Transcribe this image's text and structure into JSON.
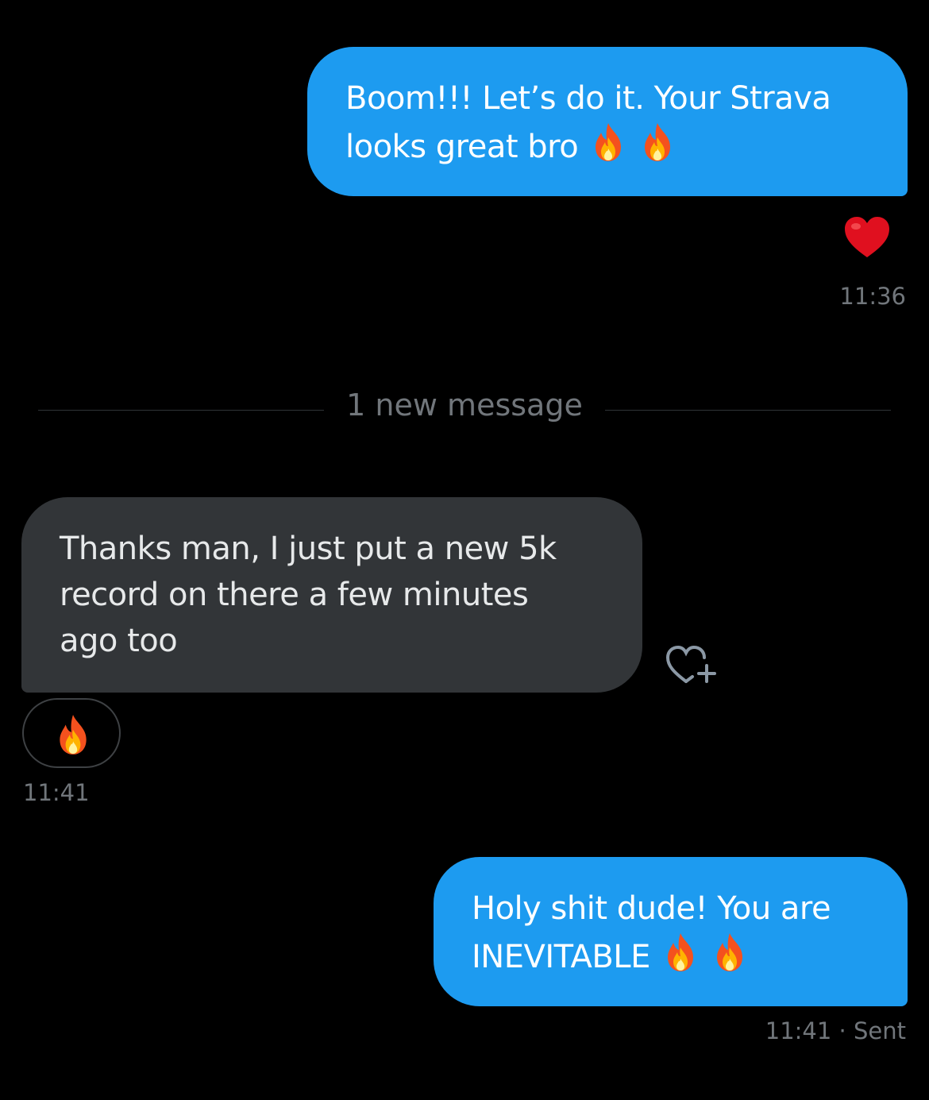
{
  "messages": [
    {
      "direction": "sent",
      "lines": [
        "Boom!!! Let’s do it. Your Strava",
        "looks great bro"
      ],
      "inline_emoji": [
        "fire-emoji",
        "fire-emoji"
      ],
      "reaction": "heart-emoji",
      "time": "11:36"
    },
    {
      "direction": "received",
      "lines": [
        "Thanks man, I just put a new 5k",
        "record on there a few minutes",
        "ago too"
      ],
      "reaction": "fire-emoji",
      "add_reaction_icon": "heart-plus-icon",
      "time": "11:41"
    },
    {
      "direction": "sent",
      "lines": [
        "Holy shit dude! You are",
        "INEVITABLE"
      ],
      "inline_emoji": [
        "fire-emoji",
        "fire-emoji"
      ],
      "time": "11:41",
      "status": "Sent"
    }
  ],
  "divider": {
    "label": "1 new message"
  },
  "colors": {
    "background": "#000000",
    "sent_bubble": "#1d9bf0",
    "received_bubble": "#323538",
    "meta_text": "#71767b",
    "heart": "#e0101f"
  }
}
